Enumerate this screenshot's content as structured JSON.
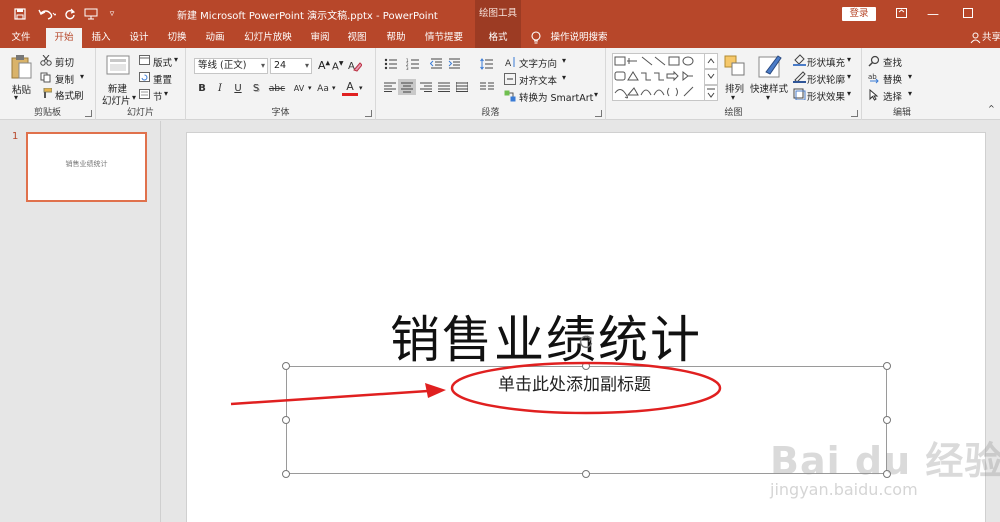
{
  "titlebar": {
    "document_title": "新建 Microsoft PowerPoint 演示文稿.pptx  -  PowerPoint",
    "context_label": "绘图工具",
    "login_label": "登录"
  },
  "tabs": {
    "file": "文件",
    "home": "开始",
    "insert": "插入",
    "design": "设计",
    "transitions": "切换",
    "animations": "动画",
    "slideshow": "幻灯片放映",
    "review": "审阅",
    "view": "视图",
    "help": "帮助",
    "storyboard": "情节提要",
    "format": "格式",
    "tellme": "操作说明搜索",
    "share": "共享"
  },
  "ribbon": {
    "clipboard": {
      "label": "剪贴板",
      "paste": "粘贴",
      "cut": "剪切",
      "copy": "复制",
      "format_painter": "格式刷"
    },
    "slides": {
      "label": "幻灯片",
      "new_slide_line1": "新建",
      "new_slide_line2": "幻灯片",
      "layout": "版式",
      "reset": "重置",
      "section": "节"
    },
    "font": {
      "label": "字体",
      "font_name": "等线 (正文)",
      "font_size": "24",
      "bold": "B",
      "italic": "I",
      "underline": "U",
      "strike": "abc",
      "shadow": "S",
      "spacing": "AV",
      "case": "Aa",
      "color": "A"
    },
    "paragraph": {
      "label": "段落",
      "text_direction": "文字方向",
      "align_text": "对齐文本",
      "smartart": "转换为 SmartArt"
    },
    "drawing": {
      "label": "绘图",
      "arrange": "排列",
      "quick_styles": "快速样式",
      "shape_fill": "形状填充",
      "shape_outline": "形状轮廓",
      "shape_effects": "形状效果"
    },
    "editing": {
      "label": "编辑",
      "find": "查找",
      "replace": "替换",
      "select": "选择"
    }
  },
  "slides_pane": {
    "slide_number": "1",
    "thumb_title": "销售业绩统计"
  },
  "slide": {
    "title": "销售业绩统计",
    "subtitle_placeholder": "单击此处添加副标题"
  },
  "watermark": {
    "brand": "Bai du 经验",
    "url": "jingyan.baidu.com"
  },
  "colors": {
    "accent": "#b7472a",
    "annotation": "#e02020"
  }
}
